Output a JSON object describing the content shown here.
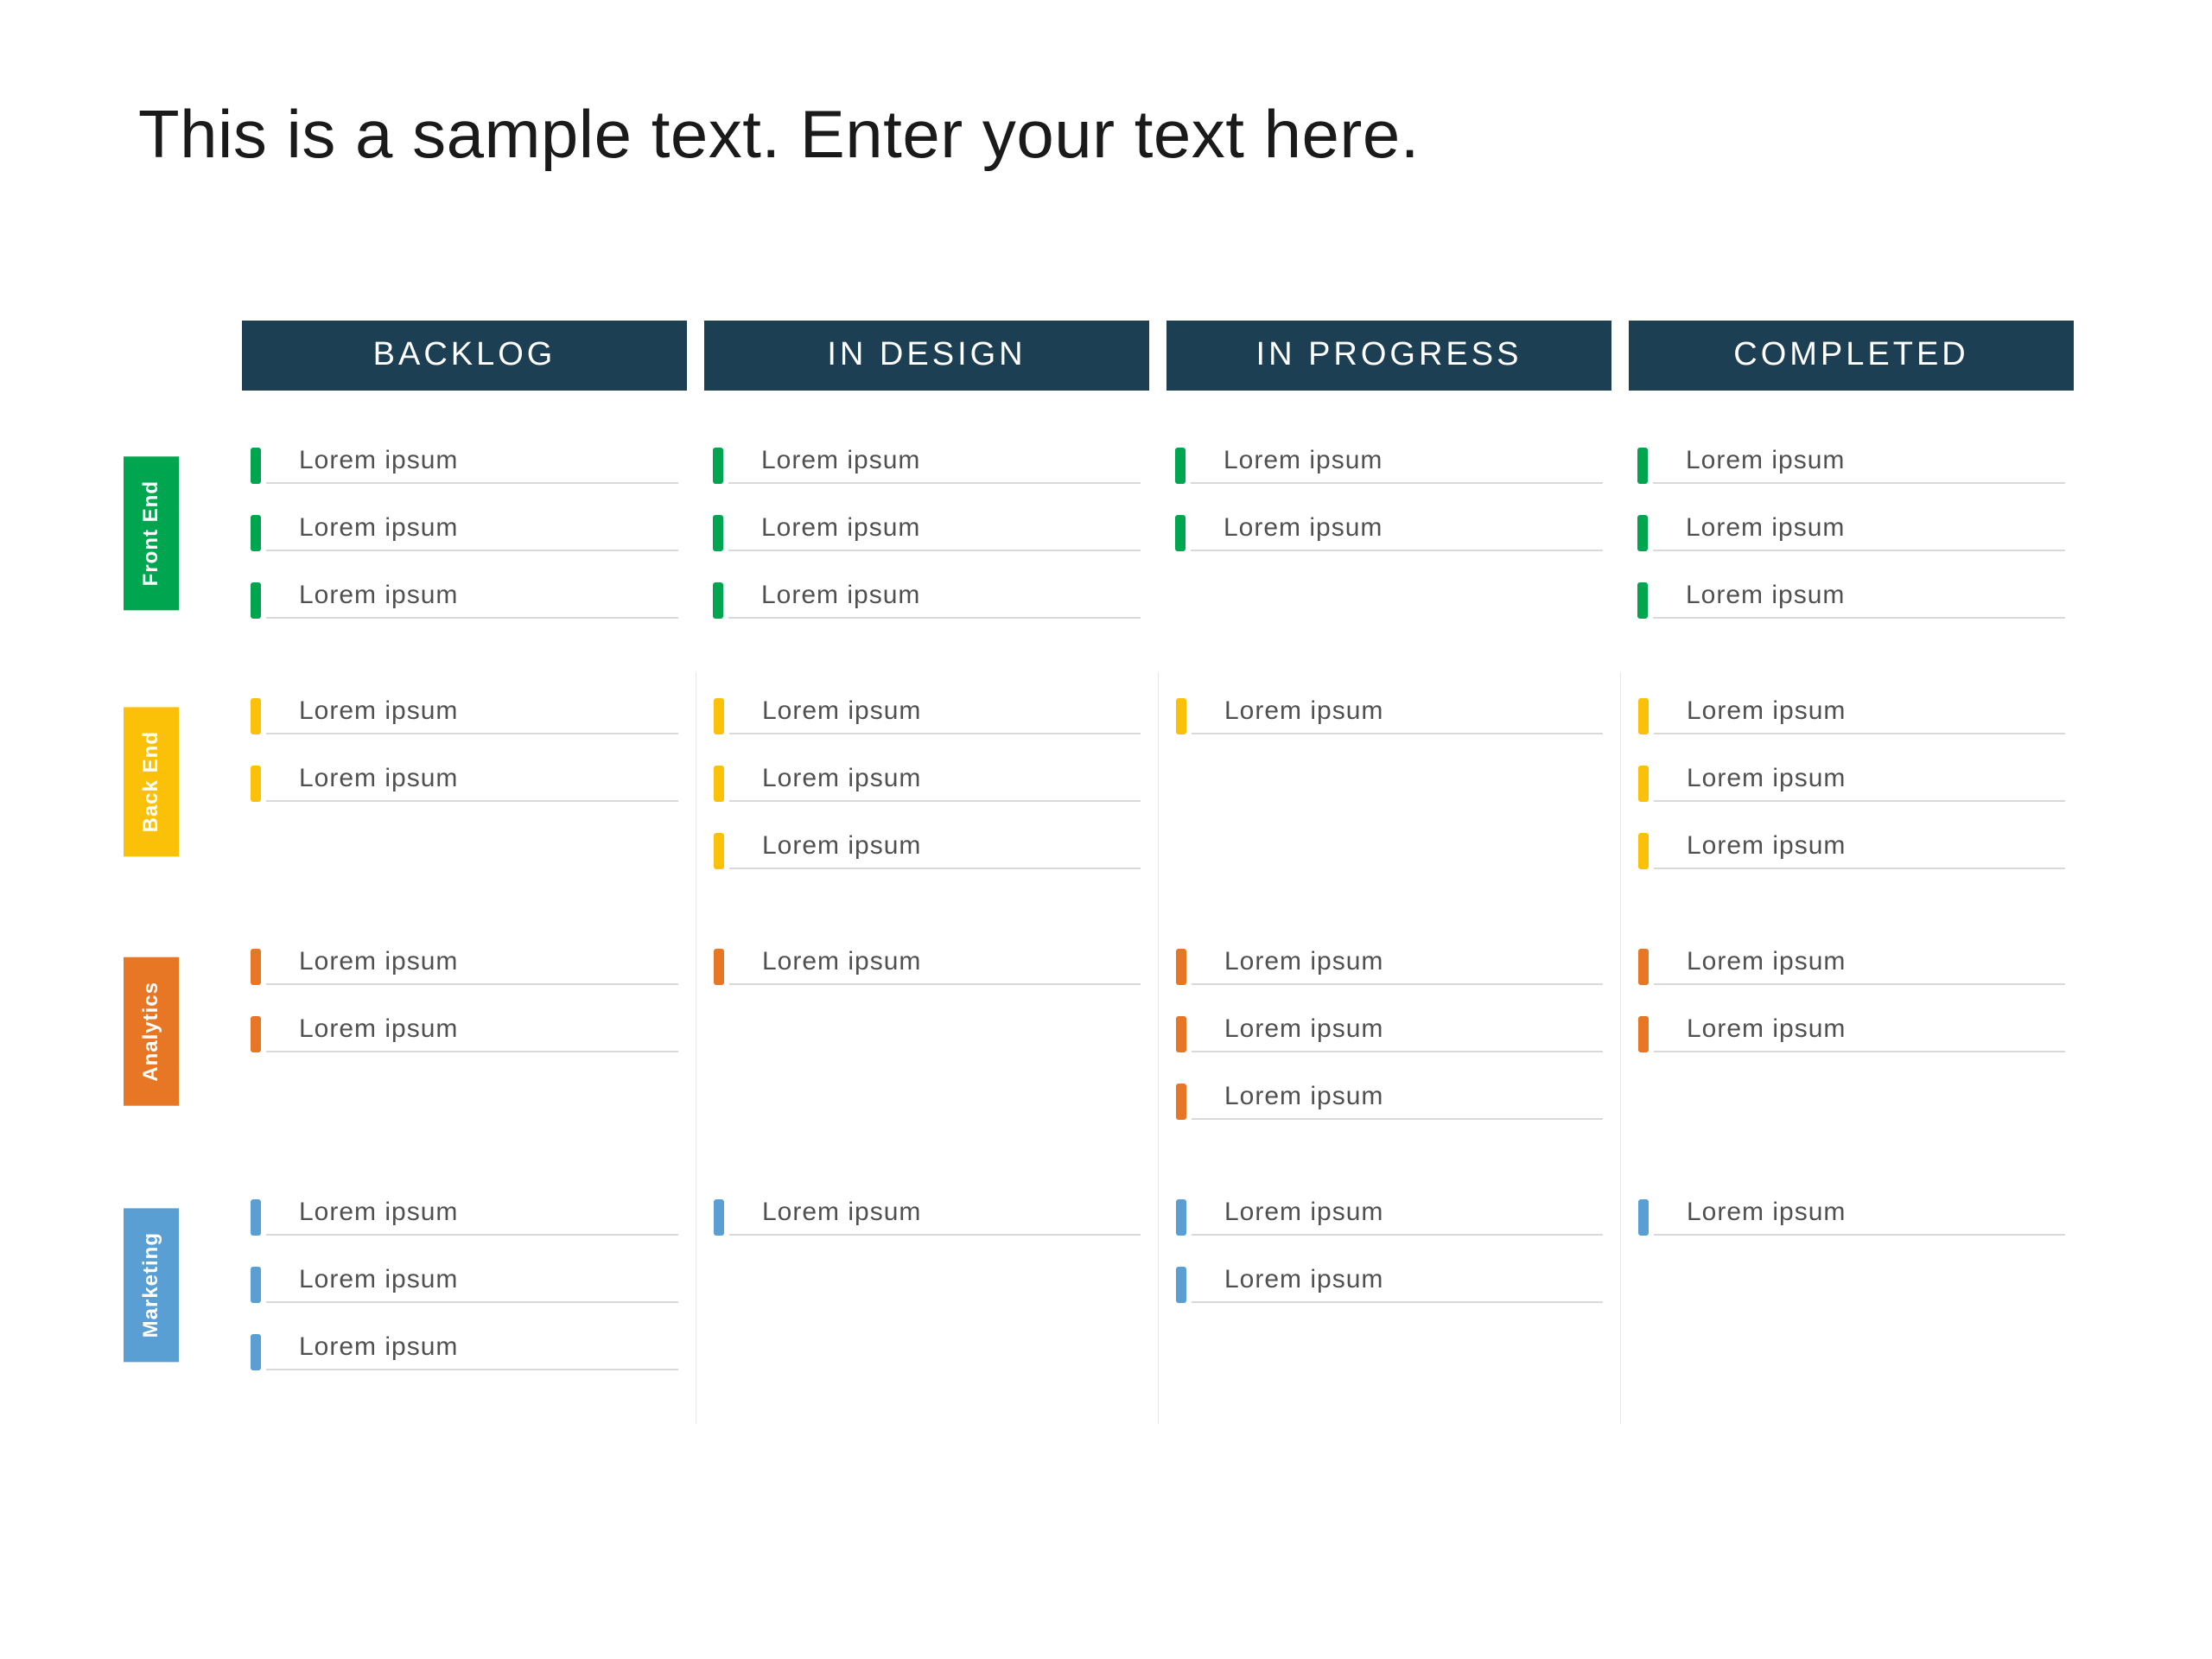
{
  "title": "This is a sample text. Enter your text here.",
  "columns": [
    {
      "id": "backlog",
      "label": "BACKLOG"
    },
    {
      "id": "in_design",
      "label": "IN DESIGN"
    },
    {
      "id": "in_progress",
      "label": "IN PROGRESS"
    },
    {
      "id": "completed",
      "label": "COMPLETED"
    }
  ],
  "lanes": [
    {
      "id": "frontend",
      "label": "Front End",
      "color": "#00a64f",
      "color_class": "c-frontend",
      "cells": {
        "backlog": [
          "Lorem ipsum",
          "Lorem ipsum",
          "Lorem ipsum"
        ],
        "in_design": [
          "Lorem ipsum",
          "Lorem ipsum",
          "Lorem ipsum"
        ],
        "in_progress": [
          "Lorem ipsum",
          "Lorem ipsum"
        ],
        "completed": [
          "Lorem ipsum",
          "Lorem ipsum",
          "Lorem ipsum"
        ]
      }
    },
    {
      "id": "backend",
      "label": "Back End",
      "color": "#fbc108",
      "color_class": "c-backend",
      "cells": {
        "backlog": [
          "Lorem ipsum",
          "Lorem ipsum"
        ],
        "in_design": [
          "Lorem ipsum",
          "Lorem ipsum",
          "Lorem ipsum"
        ],
        "in_progress": [
          "Lorem ipsum"
        ],
        "completed": [
          "Lorem ipsum",
          "Lorem ipsum",
          "Lorem ipsum"
        ]
      }
    },
    {
      "id": "analytics",
      "label": "Analytics",
      "color": "#e77724",
      "color_class": "c-analytics",
      "cells": {
        "backlog": [
          "Lorem ipsum",
          "Lorem ipsum"
        ],
        "in_design": [
          "Lorem ipsum"
        ],
        "in_progress": [
          "Lorem ipsum",
          "Lorem ipsum",
          "Lorem ipsum"
        ],
        "completed": [
          "Lorem ipsum",
          "Lorem ipsum"
        ]
      }
    },
    {
      "id": "marketing",
      "label": "Marketing",
      "color": "#5a9fd4",
      "color_class": "c-marketing",
      "cells": {
        "backlog": [
          "Lorem ipsum",
          "Lorem ipsum",
          "Lorem ipsum"
        ],
        "in_design": [
          "Lorem ipsum"
        ],
        "in_progress": [
          "Lorem ipsum",
          "Lorem ipsum"
        ],
        "completed": [
          "Lorem ipsum"
        ]
      }
    }
  ]
}
